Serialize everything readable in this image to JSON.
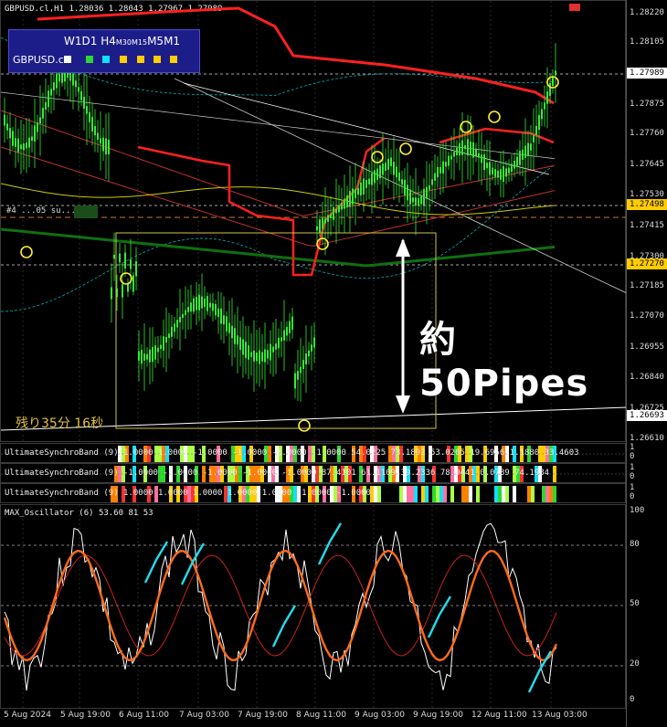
{
  "main": {
    "title": "GBPUSD.cl,H1  1.28036 1.28043 1.27967 1.27989",
    "timeframes": {
      "w1": "W1",
      "d1": "D1",
      "h4": "H4",
      "m30": "M30",
      "m15": "M15",
      "m5": "M5",
      "m1": "M1"
    },
    "symbol": "GBPUSD.cl",
    "indicator_colors": [
      "#ffffff",
      "#2ed82e",
      "#11e0ff",
      "#ffcc00",
      "#ffcc00",
      "#ffcc00",
      "#ffcc00"
    ],
    "annotation": "約50Pipes",
    "timer": "残り35分 16秒",
    "order_label": "#4 ...05 su..."
  },
  "price_axis": {
    "ticks": [
      "1.28220",
      "1.28105",
      "1.27875",
      "1.27760",
      "1.27645",
      "1.27530",
      "1.27415",
      "1.27300",
      "1.27185",
      "1.27070",
      "1.26955",
      "1.26840",
      "1.26725",
      "1.26610"
    ],
    "current": "1.27989",
    "levels": [
      "1.27498",
      "1.27270",
      "1.26693"
    ]
  },
  "synchro": [
    {
      "label": "UltimateSynchroBand (9) 1.0000 1.0000 -1.0000 -1.0000 -1.0000 -1.0000 54.0225 73.1892 53.0265 19.6956 1.1880 33.4603"
    },
    {
      "label": "UltimateSynchroBand (9) -1.0000 -1.0000 -1.0000 -1.0000 -1.0000 87.4101 61.1109 39.2336 78.9441 0.0789 74.1984"
    },
    {
      "label": "UltimateSynchroBand (9) 1.0000 1.0000 1.0000 1.0000 1.0000 -1.0000 -1.0000"
    }
  ],
  "synchro_axis": [
    "1",
    "0"
  ],
  "oscillator": {
    "label": "MAX_Oscillator (6) 53.60 81 53",
    "levels": [
      "100",
      "80",
      "50",
      "20",
      "0"
    ]
  },
  "time_axis": [
    "5 Aug 2024",
    "5 Aug 19:00",
    "6 Aug 11:00",
    "7 Aug 03:00",
    "7 Aug 19:00",
    "8 Aug 11:00",
    "9 Aug 03:00",
    "9 Aug 19:00",
    "12 Aug 11:00",
    "13 Aug 03:00"
  ],
  "colors": {
    "bull": "#33ee33",
    "sma_red": "#ff2020",
    "band": "#00d0d0",
    "yellow": "#ffd700"
  }
}
